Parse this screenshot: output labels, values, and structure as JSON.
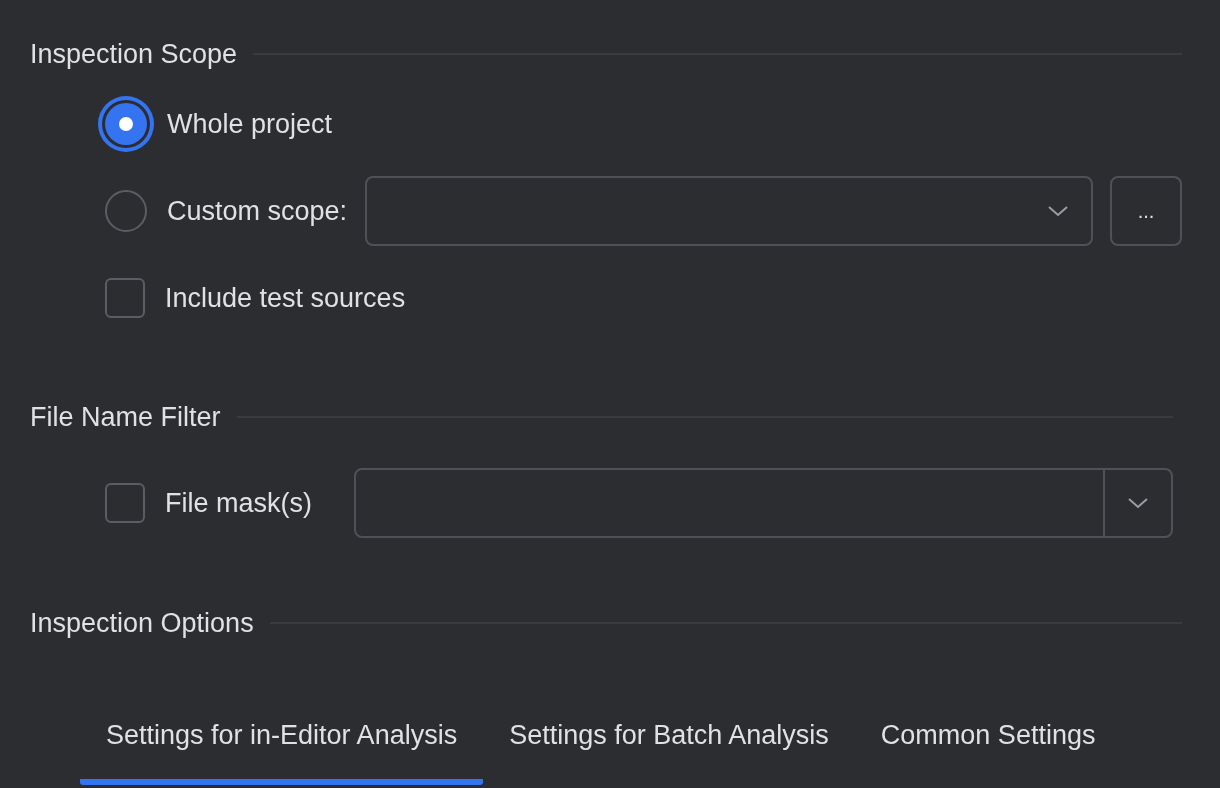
{
  "inspection_scope": {
    "title": "Inspection Scope",
    "options": [
      {
        "kind": "plain",
        "label": "Whole project",
        "selected": true
      },
      {
        "kind": "dropdown",
        "label": "Custom scope:",
        "selected": false,
        "browse_button": "..."
      }
    ],
    "include_test_sources": {
      "label": "Include test sources",
      "checked": false
    }
  },
  "file_name_filter": {
    "title": "File Name Filter",
    "file_mask": {
      "label": "File mask(s)",
      "checked": false
    }
  },
  "inspection_options": {
    "title": "Inspection Options",
    "tabs": [
      {
        "label": "Settings for in-Editor Analysis",
        "selected": true
      },
      {
        "label": "Settings for Batch Analysis",
        "selected": false
      },
      {
        "label": "Common Settings",
        "selected": false
      }
    ]
  }
}
